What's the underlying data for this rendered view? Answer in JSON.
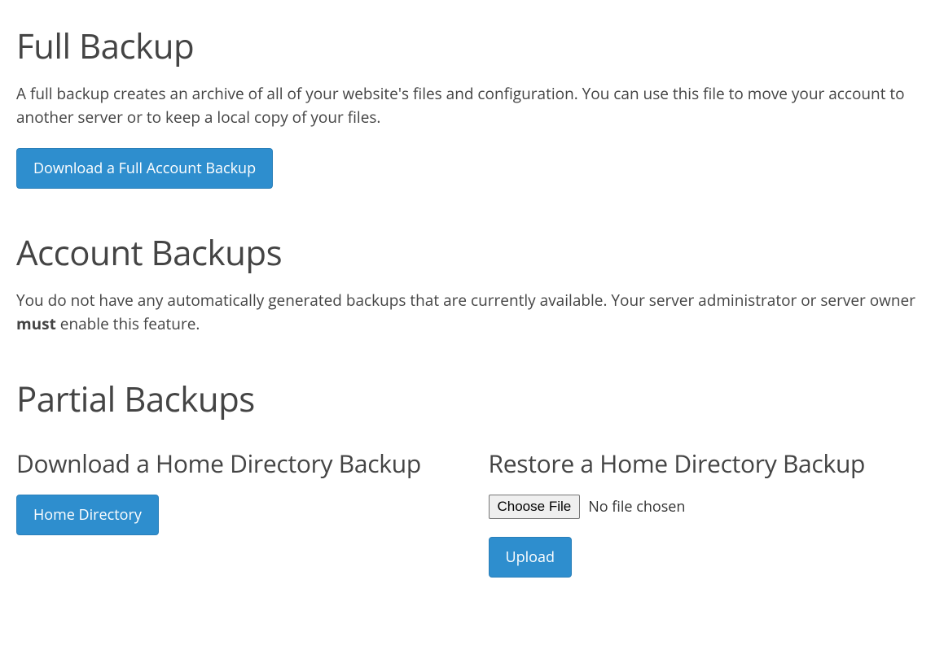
{
  "fullBackup": {
    "title": "Full Backup",
    "description": "A full backup creates an archive of all of your website's files and configuration. You can use this file to move your account to another server or to keep a local copy of your files.",
    "button": "Download a Full Account Backup"
  },
  "accountBackups": {
    "title": "Account Backups",
    "description_pre": "You do not have any automatically generated backups that are currently available. Your server administrator or server owner ",
    "description_strong": "must",
    "description_post": " enable this feature."
  },
  "partialBackups": {
    "title": "Partial Backups",
    "download": {
      "title": "Download a Home Directory Backup",
      "button": "Home Directory"
    },
    "restore": {
      "title": "Restore a Home Directory Backup",
      "chooseFile": "Choose File",
      "fileStatus": "No file chosen",
      "uploadButton": "Upload"
    }
  }
}
